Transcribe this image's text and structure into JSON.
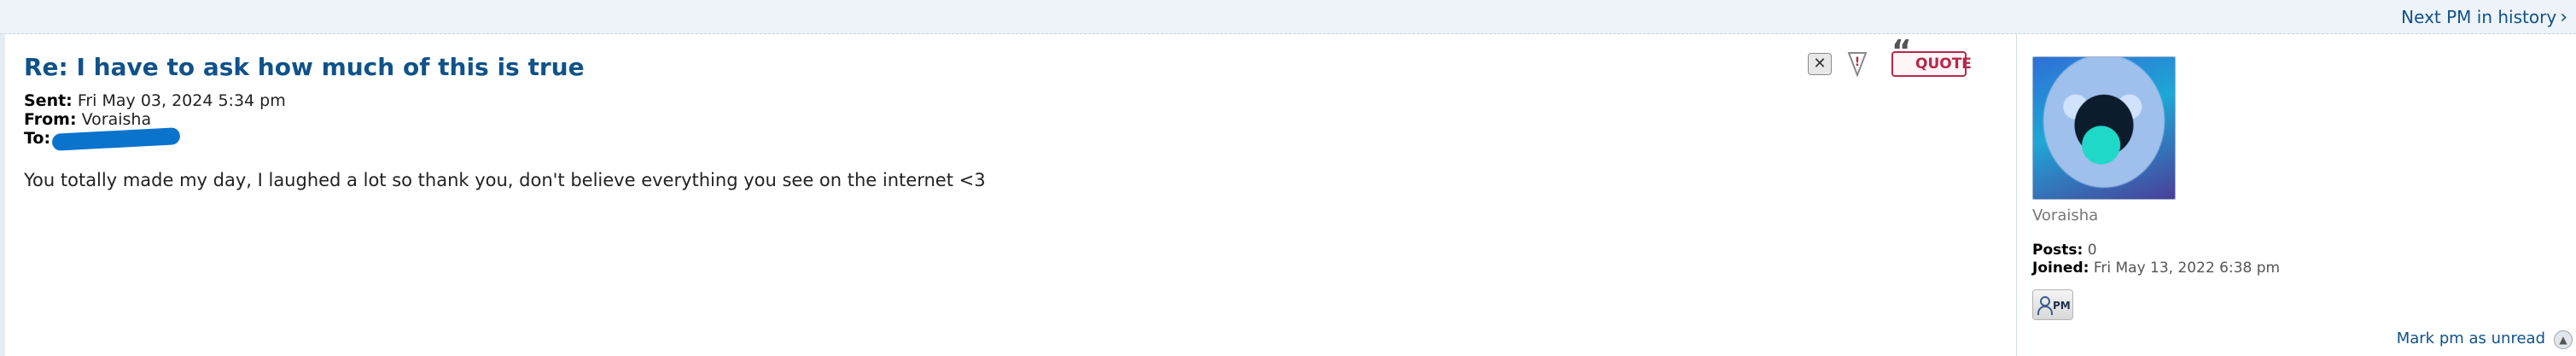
{
  "nav": {
    "next_pm_label": "Next PM in history",
    "next_icon": "chevron-right-icon"
  },
  "message": {
    "subject": "Re: I have to ask how much of this is true",
    "sent_label": "Sent:",
    "sent_value": "Fri May 03, 2024 5:34 pm",
    "from_label": "From:",
    "from_value": "Voraisha",
    "to_label": "To:",
    "body": "You totally made my day, I laughed a lot so thank you, don't believe everything you see on the internet <3"
  },
  "buttons": {
    "delete_icon": "close-icon",
    "report_icon": "report-icon",
    "quote_label": "QUOTE"
  },
  "profile": {
    "username": "Voraisha",
    "posts_label": "Posts:",
    "posts_value": "0",
    "joined_label": "Joined:",
    "joined_value": "Fri May 13, 2022 6:38 pm",
    "pm_label": "PM"
  },
  "footer": {
    "mark_unread_label": "Mark pm as unread",
    "top_icon": "back-to-top-icon"
  },
  "colors": {
    "link": "#105289",
    "quote": "#b5294a",
    "redaction": "#0a73cc"
  }
}
